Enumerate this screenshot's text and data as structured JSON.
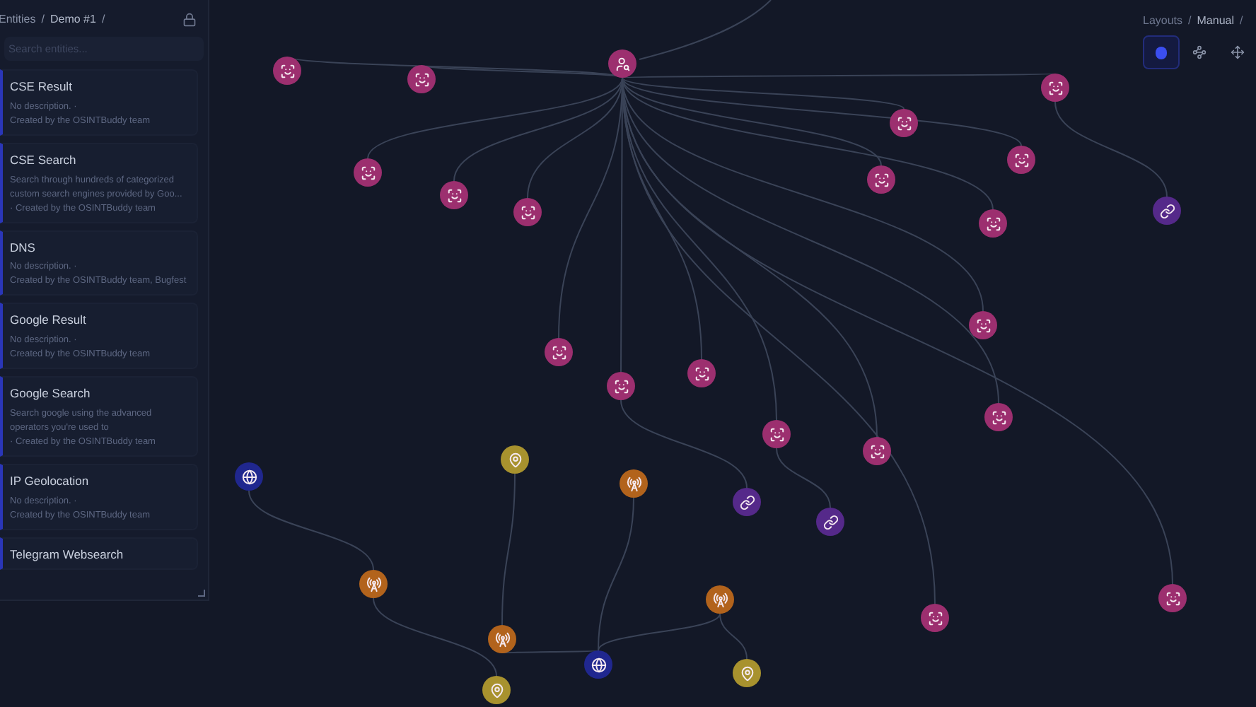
{
  "sidebar": {
    "breadcrumb": [
      "Entities",
      "Demo #1"
    ],
    "breadcrumb_separator": "/",
    "entity_separator": "·",
    "search": {
      "placeholder": "Search entities..."
    },
    "entities": [
      {
        "title": "CSE Result",
        "description": "No description.",
        "author": "Created by the OSINTBuddy team"
      },
      {
        "title": "CSE Search",
        "description": "Search through hundreds of categorized custom search engines provided by Goo...",
        "author": "Created by the OSINTBuddy team"
      },
      {
        "title": "DNS",
        "description": "No description.",
        "author": "Created by the OSINTBuddy team, Bugfest"
      },
      {
        "title": "Google Result",
        "description": "No description.",
        "author": "Created by the OSINTBuddy team"
      },
      {
        "title": "Google Search",
        "description": "Search google using the advanced operators you're used to",
        "author": "Created by the OSINTBuddy team"
      },
      {
        "title": "IP Geolocation",
        "description": "No description.",
        "author": "Created by the OSINTBuddy team"
      },
      {
        "title": "Telegram Websearch"
      }
    ]
  },
  "layouts": {
    "breadcrumb": [
      "Layouts",
      "Manual"
    ],
    "breadcrumb_separator": "/",
    "tools": [
      {
        "kind": "dot",
        "selected": true
      },
      {
        "kind": "scatter",
        "selected": false
      },
      {
        "kind": "move",
        "selected": false
      }
    ]
  },
  "graph": {
    "nodes": [
      {
        "kind": "user-search"
      },
      {
        "kind": "face"
      },
      {
        "kind": "face"
      },
      {
        "kind": "face"
      },
      {
        "kind": "face"
      },
      {
        "kind": "face"
      },
      {
        "kind": "face"
      },
      {
        "kind": "face"
      },
      {
        "kind": "face"
      },
      {
        "kind": "face"
      },
      {
        "kind": "face"
      },
      {
        "kind": "face"
      },
      {
        "kind": "face"
      },
      {
        "kind": "face"
      },
      {
        "kind": "face"
      },
      {
        "kind": "face"
      },
      {
        "kind": "face"
      },
      {
        "kind": "face"
      },
      {
        "kind": "face"
      },
      {
        "kind": "face"
      },
      {
        "kind": "link"
      },
      {
        "kind": "link"
      },
      {
        "kind": "link"
      },
      {
        "kind": "globe"
      },
      {
        "kind": "globe"
      },
      {
        "kind": "antenna"
      },
      {
        "kind": "antenna"
      },
      {
        "kind": "antenna"
      },
      {
        "kind": "antenna"
      },
      {
        "kind": "pin"
      },
      {
        "kind": "pin"
      },
      {
        "kind": "pin"
      }
    ]
  }
}
